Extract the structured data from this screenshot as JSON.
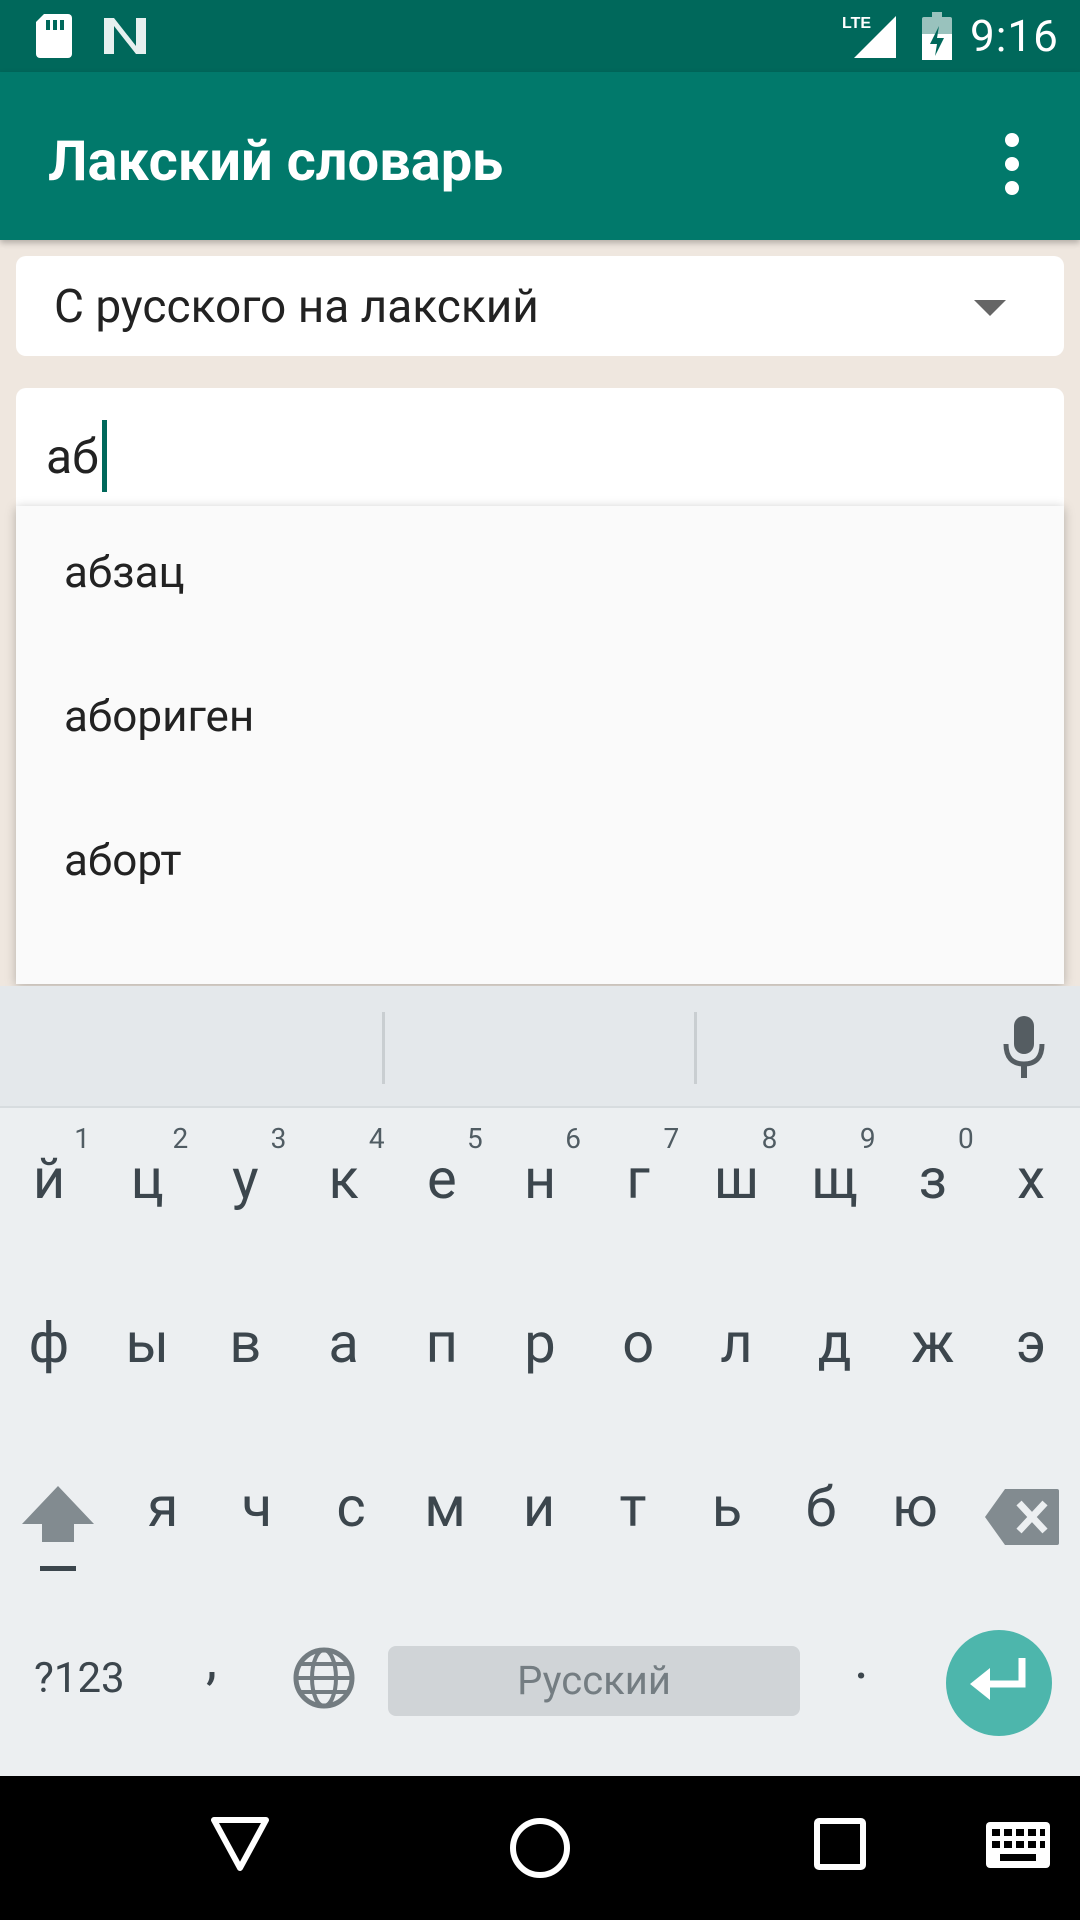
{
  "status_bar": {
    "time": "9:16",
    "network": "LTE",
    "icons": [
      "sd-card-icon",
      "n-logo-icon",
      "lte-signal-icon",
      "battery-icon"
    ]
  },
  "app_bar": {
    "title": "Лакский словарь",
    "overflow_icon": "more-vert-icon"
  },
  "direction_spinner": {
    "selected": "С русского на лакский"
  },
  "search": {
    "value": "аб"
  },
  "suggestions": [
    "абзац",
    "абориген",
    "аборт"
  ],
  "keyboard": {
    "row1": [
      {
        "ch": "й",
        "num": "1"
      },
      {
        "ch": "ц",
        "num": "2"
      },
      {
        "ch": "у",
        "num": "3"
      },
      {
        "ch": "к",
        "num": "4"
      },
      {
        "ch": "е",
        "num": "5"
      },
      {
        "ch": "н",
        "num": "6"
      },
      {
        "ch": "г",
        "num": "7"
      },
      {
        "ch": "ш",
        "num": "8"
      },
      {
        "ch": "щ",
        "num": "9"
      },
      {
        "ch": "з",
        "num": "0"
      },
      {
        "ch": "х",
        "num": ""
      }
    ],
    "row2": [
      "ф",
      "ы",
      "в",
      "а",
      "п",
      "р",
      "о",
      "л",
      "д",
      "ж",
      "э"
    ],
    "row3": [
      "я",
      "ч",
      "с",
      "м",
      "и",
      "т",
      "ь",
      "б",
      "ю"
    ],
    "symbols_label": "?123",
    "comma": ",",
    "space_label": "Русский",
    "period": "."
  },
  "colors": {
    "status_bar": "#00685b",
    "app_bar": "#01796b",
    "accent": "#4db6ac"
  }
}
